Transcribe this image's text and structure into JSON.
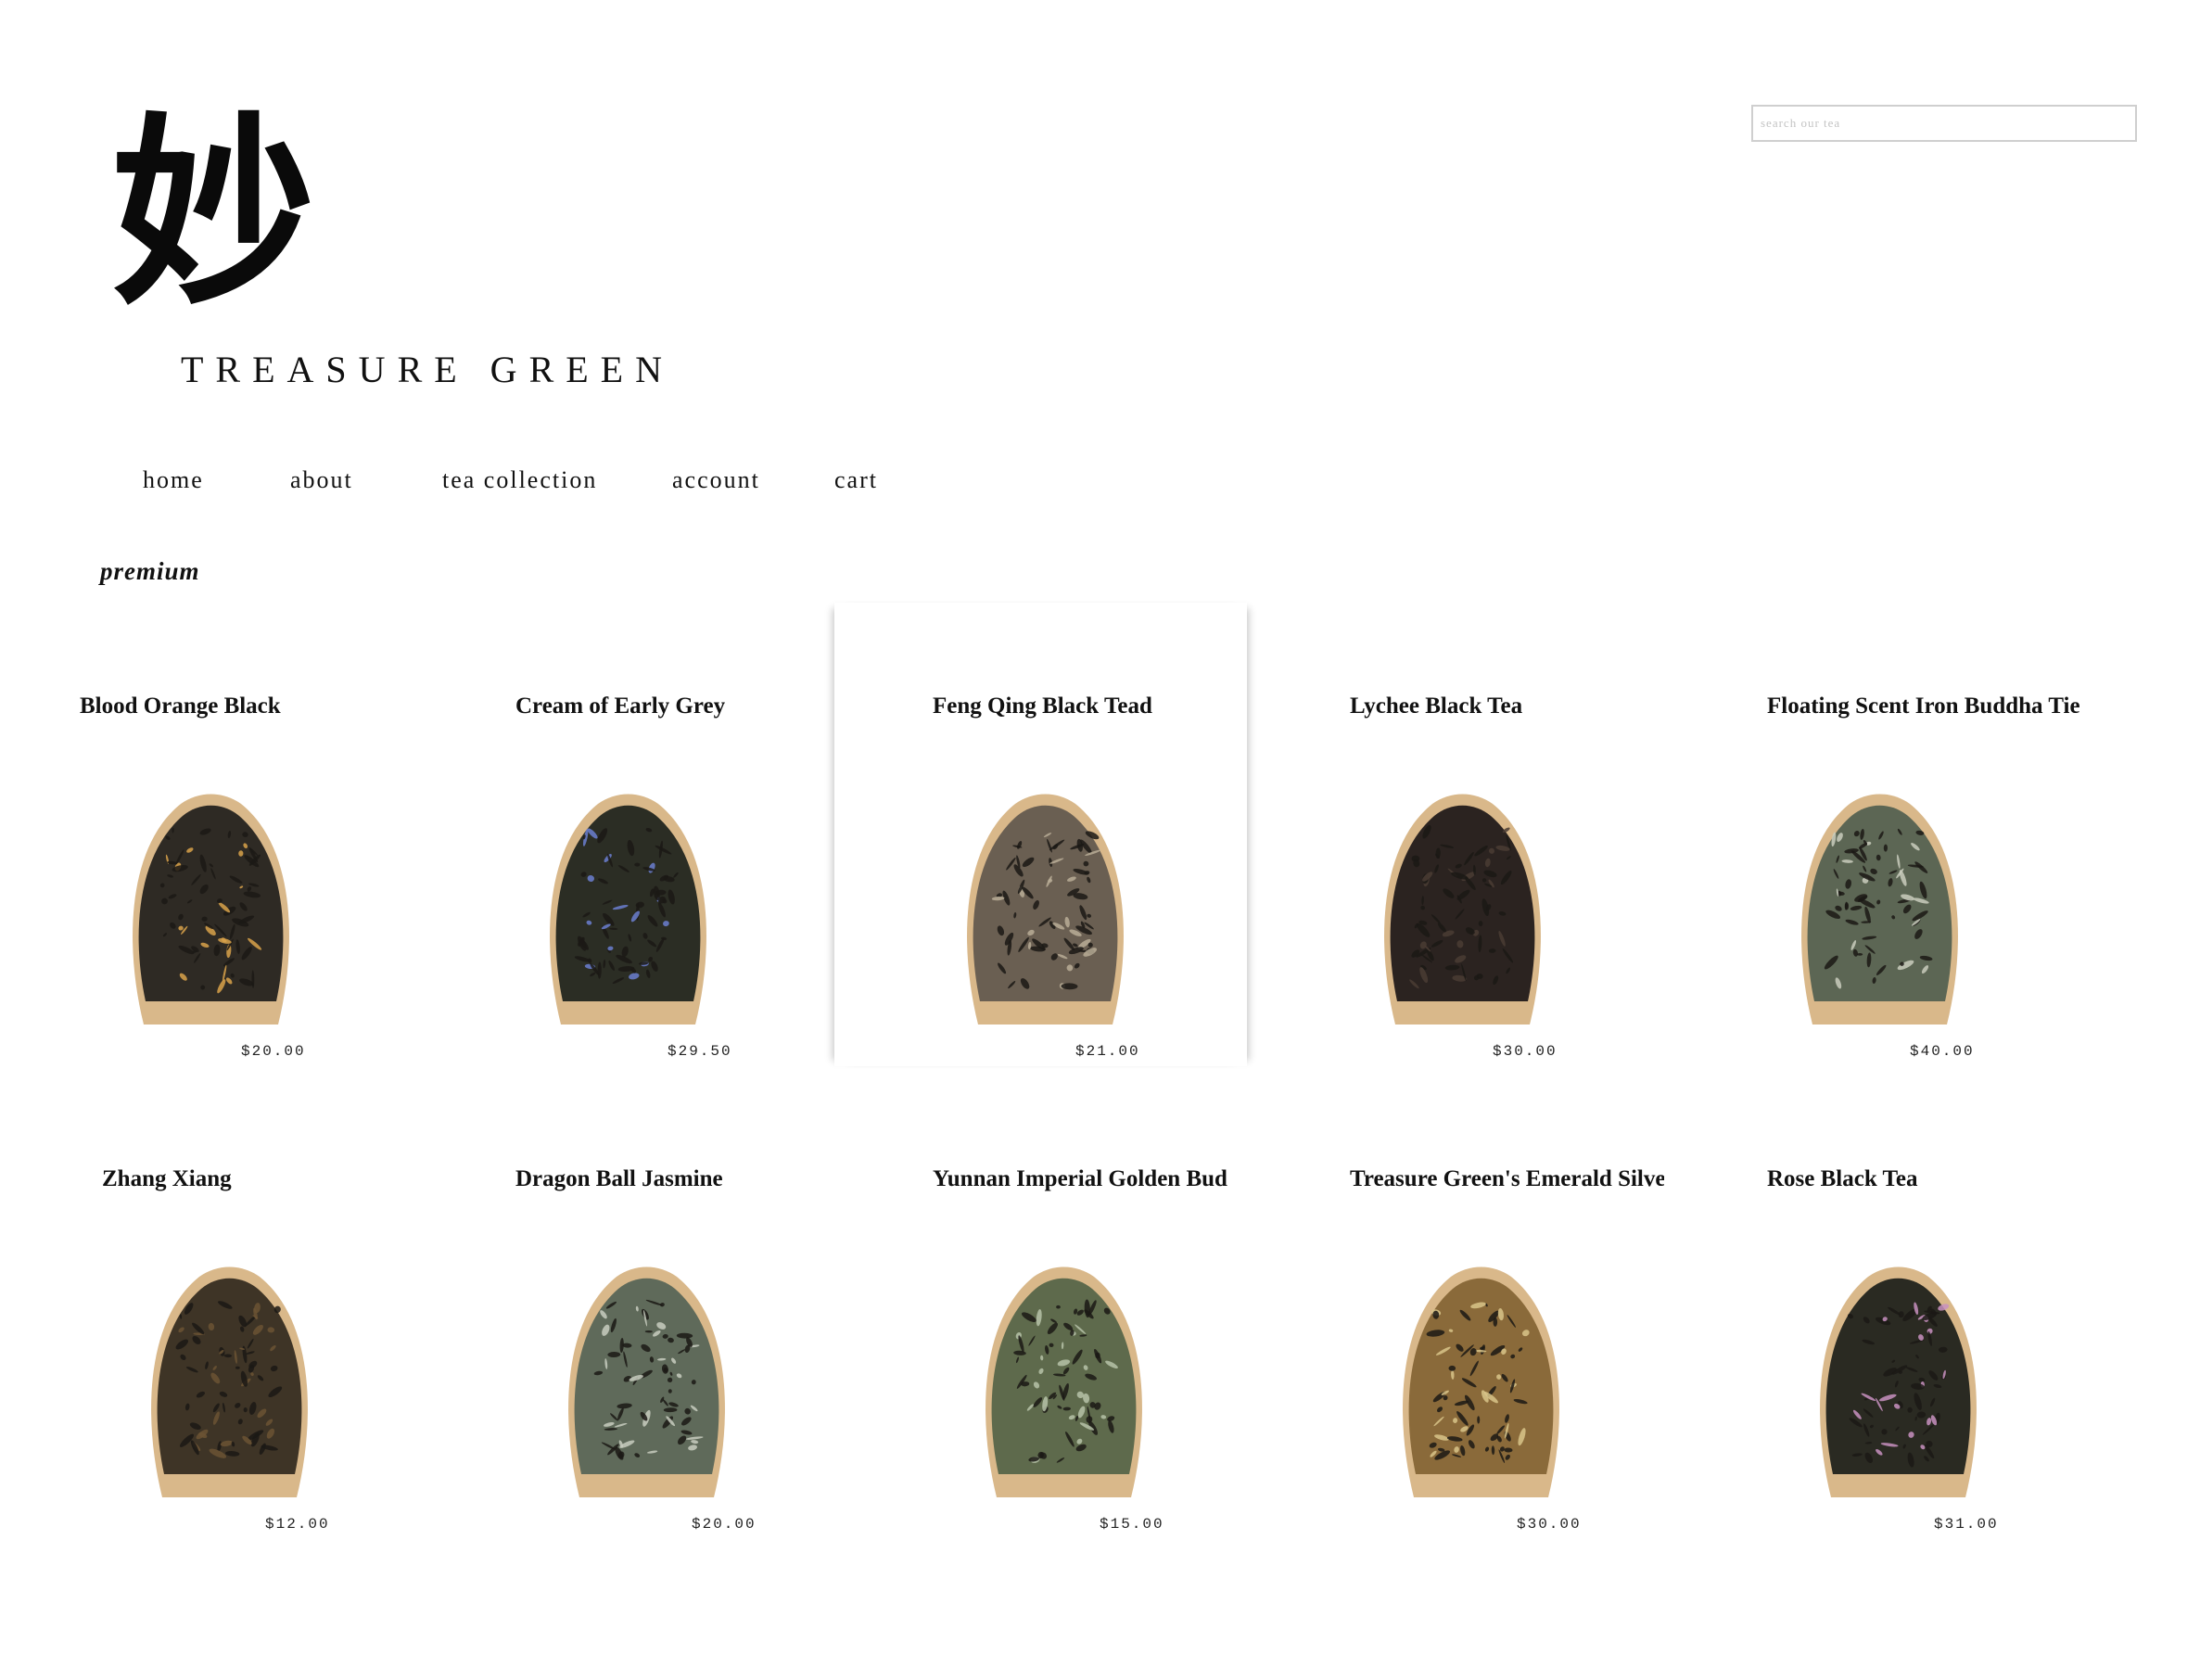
{
  "brand": {
    "name": "TREASURE GREEN",
    "logo_char": "妙"
  },
  "search": {
    "placeholder": "search our tea",
    "value": ""
  },
  "nav": {
    "items": [
      "home",
      "about",
      "tea collection",
      "account",
      "cart"
    ]
  },
  "section": {
    "label": "premium"
  },
  "products": [
    {
      "name": "Blood Orange Black",
      "price": "$20.00",
      "leaf": "#2e2a24",
      "speck": "#d8a24a"
    },
    {
      "name": "Cream of Early Grey",
      "price": "$29.50",
      "leaf": "#2b2d24",
      "speck": "#6b7fd0"
    },
    {
      "name": "Feng Qing Black Tead",
      "price": "$21.00",
      "leaf": "#6a5f52",
      "speck": "#b8ad96"
    },
    {
      "name": "Lychee Black Tea",
      "price": "$30.00",
      "leaf": "#2b2320",
      "speck": "#4a3c34"
    },
    {
      "name": "Floating Scent Iron Buddha Tie",
      "price": "$40.00",
      "leaf": "#5c6654",
      "speck": "#c9ccbd"
    },
    {
      "name": "Zhang Xiang",
      "price": "$12.00",
      "leaf": "#3e3426",
      "speck": "#6b5334"
    },
    {
      "name": "Dragon Ball Jasmine",
      "price": "$20.00",
      "leaf": "#5f6a5a",
      "speck": "#c8ccbf"
    },
    {
      "name": "Yunnan Imperial Golden Bud",
      "price": "$15.00",
      "leaf": "#5e6a4c",
      "speck": "#b6c2a8"
    },
    {
      "name": "Treasure Green's Emerald Silver",
      "price": "$30.00",
      "leaf": "#8a6a3a",
      "speck": "#d8c48a"
    },
    {
      "name": "Rose Black Tea",
      "price": "$31.00",
      "leaf": "#2a2a22",
      "speck": "#c890c0"
    }
  ]
}
